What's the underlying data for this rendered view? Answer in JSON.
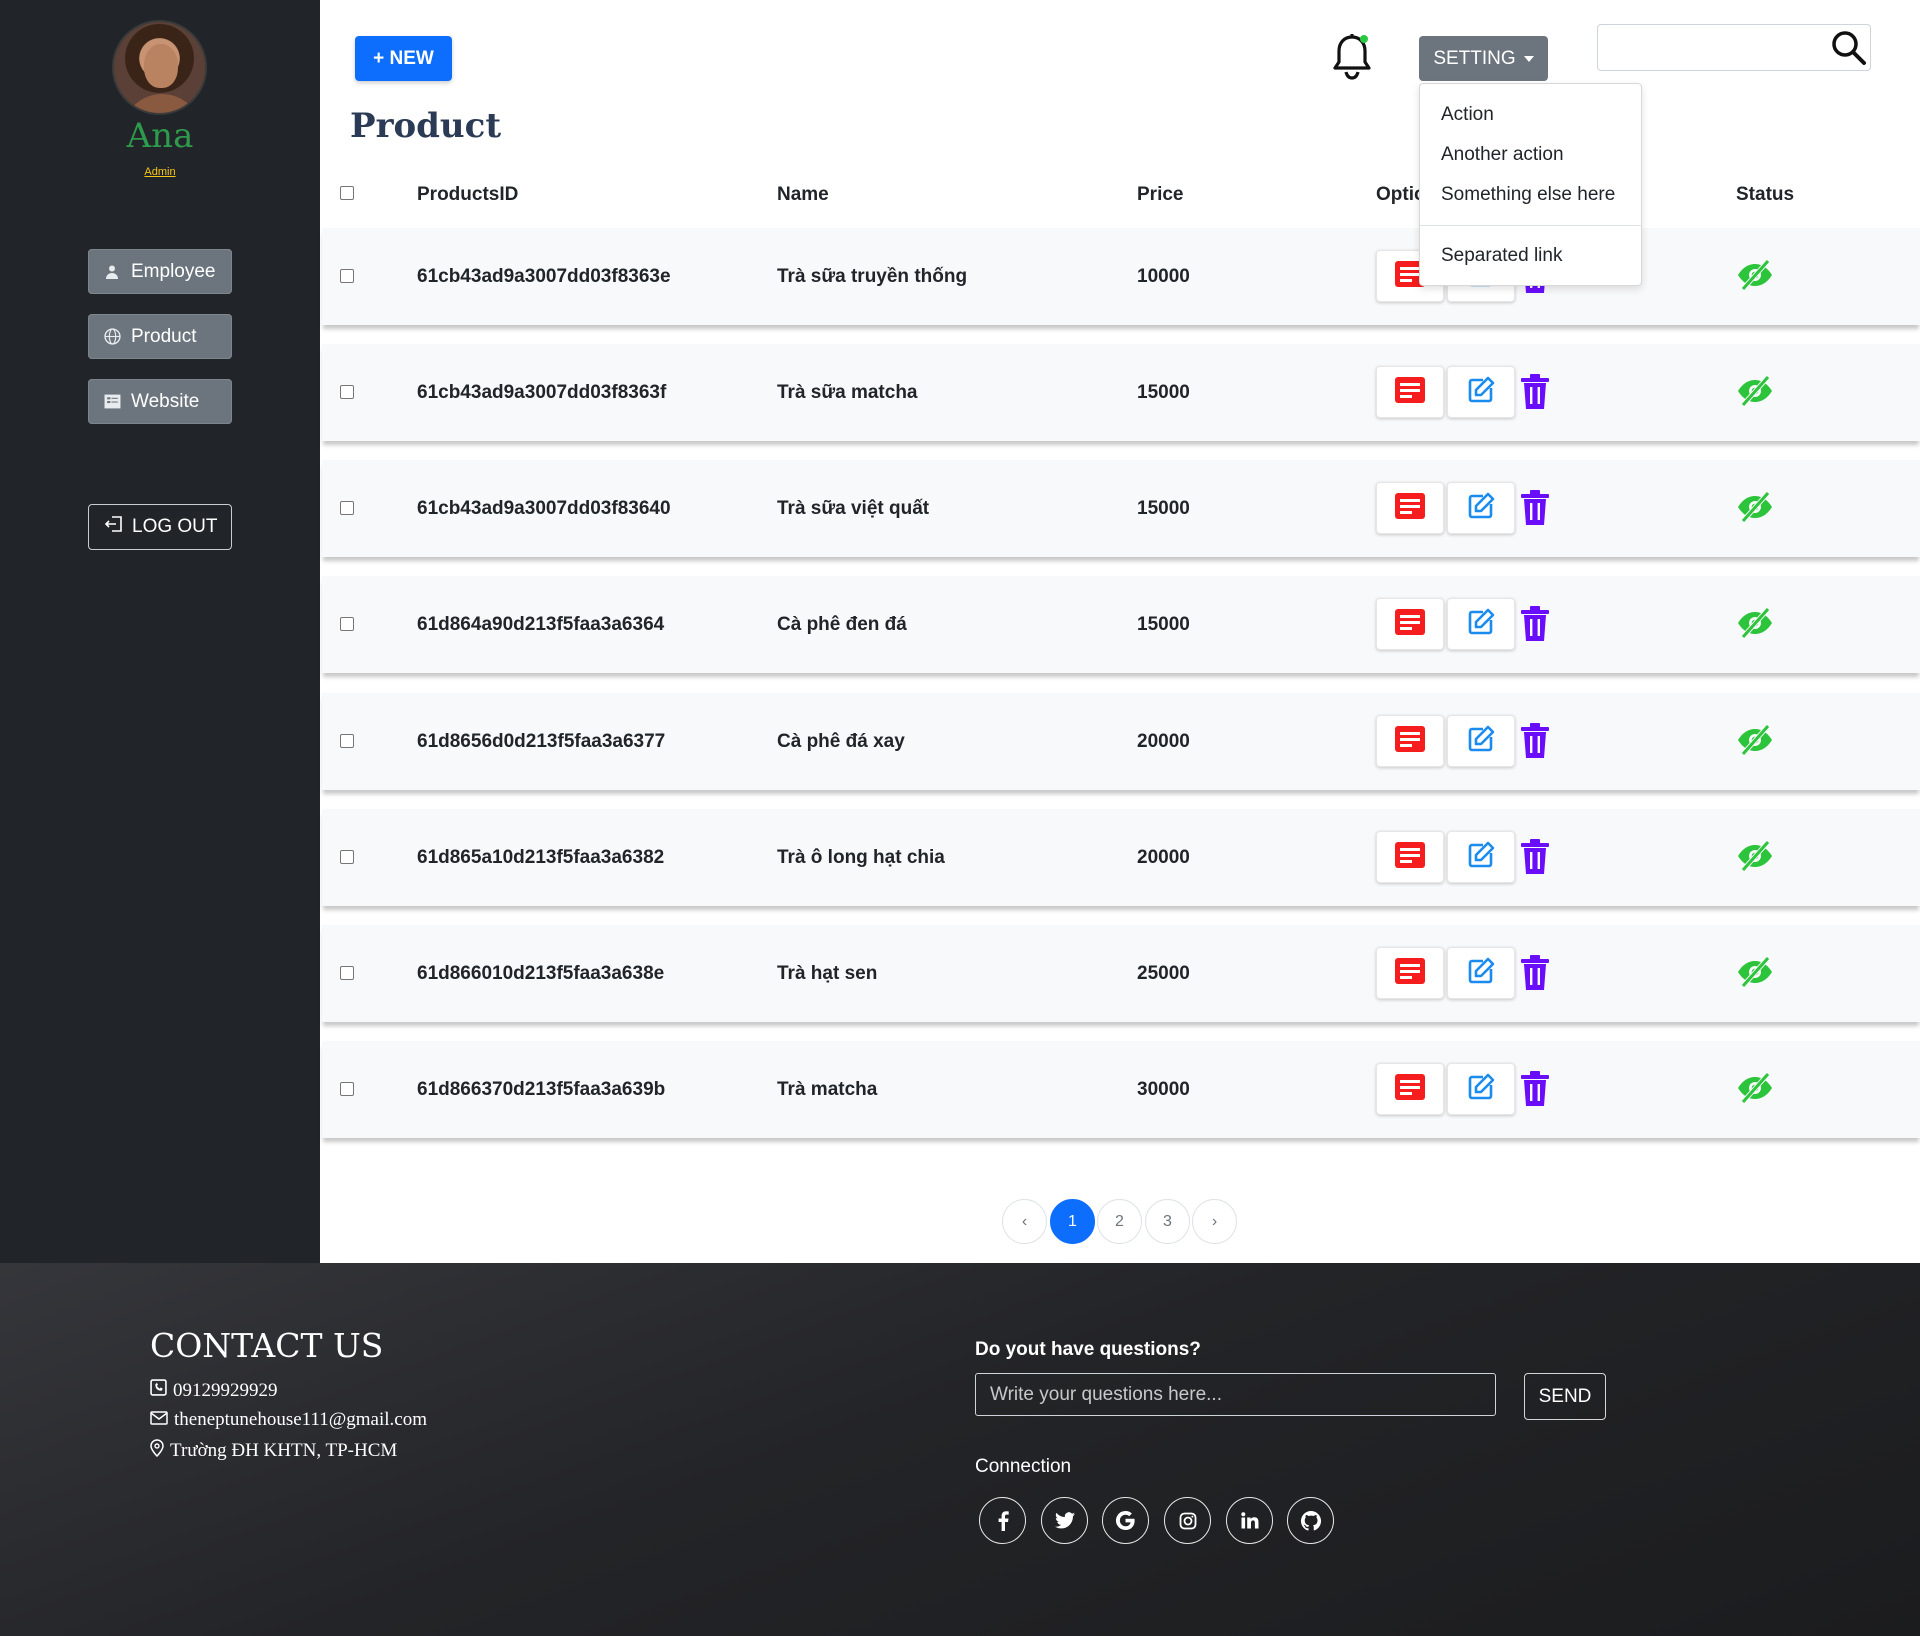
{
  "sidebar": {
    "user_name": "Ana",
    "user_role": "Admin",
    "nav": [
      {
        "label": "Employee",
        "icon": "user-icon"
      },
      {
        "label": "Product",
        "icon": "globe-icon"
      },
      {
        "label": "Website",
        "icon": "list-icon"
      }
    ],
    "logout_label": "LOG OUT"
  },
  "topbar": {
    "new_label": "+ NEW",
    "setting_label": "SETTING",
    "search_placeholder": "",
    "notification_indicator_color": "#28c840"
  },
  "page_title": "Product",
  "table": {
    "headers": [
      "ProductsID",
      "Name",
      "Price",
      "Options",
      "Status"
    ],
    "rows": [
      {
        "id": "61cb43ad9a3007dd03f8363e",
        "name": "Trà sữa truyền thống",
        "price": "10000"
      },
      {
        "id": "61cb43ad9a3007dd03f8363f",
        "name": "Trà sữa matcha",
        "price": "15000"
      },
      {
        "id": "61cb43ad9a3007dd03f83640",
        "name": "Trà sữa việt quất",
        "price": "15000"
      },
      {
        "id": "61d864a90d213f5faa3a6364",
        "name": "Cà phê đen đá",
        "price": "15000"
      },
      {
        "id": "61d8656d0d213f5faa3a6377",
        "name": "Cà phê đá xay",
        "price": "20000"
      },
      {
        "id": "61d865a10d213f5faa3a6382",
        "name": "Trà ô long hạt chia",
        "price": "20000"
      },
      {
        "id": "61d866010d213f5faa3a638e",
        "name": "Trà hạt sen",
        "price": "25000"
      },
      {
        "id": "61d866370d213f5faa3a639b",
        "name": "Trà matcha",
        "price": "30000"
      }
    ]
  },
  "dropdown": {
    "items": [
      "Action",
      "Another action",
      "Something else here"
    ],
    "separated": "Separated link"
  },
  "pagination": {
    "prev": "‹",
    "pages": [
      "1",
      "2",
      "3"
    ],
    "active": "1",
    "next": "›"
  },
  "footer": {
    "contact_title": "CONTACT US",
    "phone": "09129929929",
    "email": "theneptunehouse111@gmail.com",
    "address": "Trường ĐH KHTN, TP-HCM",
    "question_title": "Do yout have questions?",
    "question_placeholder": "Write your questions here...",
    "send_label": "SEND",
    "connection_title": "Connection",
    "socials": [
      "facebook-icon",
      "twitter-icon",
      "google-icon",
      "instagram-icon",
      "linkedin-icon",
      "github-icon"
    ]
  },
  "colors": {
    "primary": "#0d6efd",
    "sidebar_bg": "#212529",
    "secondary_btn": "#6c757d",
    "name_green": "#2e9a4c",
    "view_red": "#f51d1d",
    "edit_blue": "#1a8cf0",
    "trash_purple": "#6a0dfb",
    "status_green": "#2bc43a"
  }
}
